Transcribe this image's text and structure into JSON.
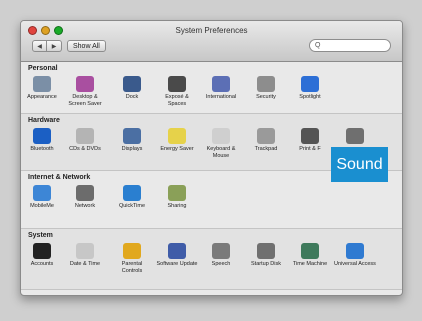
{
  "window": {
    "title": "System Preferences",
    "show_all": "Show All",
    "search_placeholder": "",
    "traffic_colors": [
      "#e0443e",
      "#dea123",
      "#1aab29"
    ]
  },
  "sections": [
    {
      "title": "Personal",
      "items": [
        {
          "label": "Appearance",
          "icon": "appearance-icon",
          "color": "#7b8fa6"
        },
        {
          "label": "Desktop & Screen Saver",
          "icon": "desktop-icon",
          "color": "#a94fa0"
        },
        {
          "label": "Dock",
          "icon": "dock-icon",
          "color": "#3a5a8c"
        },
        {
          "label": "Exposé & Spaces",
          "icon": "expose-icon",
          "color": "#4a4a4a"
        },
        {
          "label": "International",
          "icon": "international-icon",
          "color": "#5c6fb5"
        },
        {
          "label": "Security",
          "icon": "security-icon",
          "color": "#8d8d8d"
        },
        {
          "label": "Spotlight",
          "icon": "spotlight-icon",
          "color": "#2d6fd6"
        }
      ]
    },
    {
      "title": "Hardware",
      "items": [
        {
          "label": "Bluetooth",
          "icon": "bluetooth-icon",
          "color": "#1b5fc4"
        },
        {
          "label": "CDs & DVDs",
          "icon": "cd-icon",
          "color": "#b4b4b4"
        },
        {
          "label": "Displays",
          "icon": "displays-icon",
          "color": "#4b6fa3"
        },
        {
          "label": "Energy Saver",
          "icon": "energy-icon",
          "color": "#e6d24a"
        },
        {
          "label": "Keyboard & Mouse",
          "icon": "keyboard-icon",
          "color": "#cfcfcf"
        },
        {
          "label": "Trackpad",
          "icon": "trackpad-icon",
          "color": "#9a9a9a"
        },
        {
          "label": "Print & F",
          "icon": "print-icon",
          "color": "#555555"
        },
        {
          "label": "",
          "icon": "sound-icon",
          "color": "#6f6f6f"
        }
      ]
    },
    {
      "title": "Internet & Network",
      "items": [
        {
          "label": "MobileMe",
          "icon": "mobileme-icon",
          "color": "#3d86d6"
        },
        {
          "label": "Network",
          "icon": "network-icon",
          "color": "#6c6c6c"
        },
        {
          "label": "QuickTime",
          "icon": "quicktime-icon",
          "color": "#2a7fd0"
        },
        {
          "label": "Sharing",
          "icon": "sharing-icon",
          "color": "#8aa058"
        }
      ]
    },
    {
      "title": "System",
      "items": [
        {
          "label": "Accounts",
          "icon": "accounts-icon",
          "color": "#222222"
        },
        {
          "label": "Date & Time",
          "icon": "datetime-icon",
          "color": "#c7c7c7"
        },
        {
          "label": "Parental Controls",
          "icon": "parental-icon",
          "color": "#e1a81e"
        },
        {
          "label": "Software Update",
          "icon": "software-update-icon",
          "color": "#3f5ca8"
        },
        {
          "label": "Speech",
          "icon": "speech-icon",
          "color": "#7a7a7a"
        },
        {
          "label": "Startup Disk",
          "icon": "startup-disk-icon",
          "color": "#707070"
        },
        {
          "label": "Time Machine",
          "icon": "time-machine-icon",
          "color": "#3f7a5c"
        },
        {
          "label": "Universal Access",
          "icon": "universal-access-icon",
          "color": "#2f7ad1"
        }
      ]
    }
  ],
  "callout": {
    "label": "Sound",
    "color": "#1a8fd0"
  }
}
